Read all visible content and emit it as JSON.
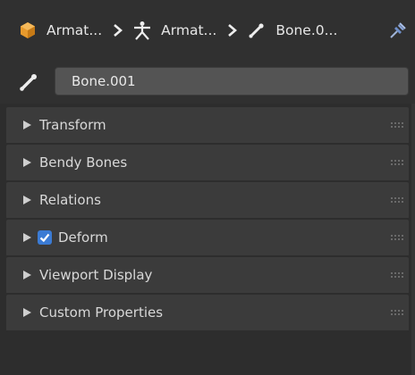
{
  "colors": {
    "panel_bg": "#2d2d2d",
    "header_bg": "#303030",
    "section_bg": "#3b3b3b",
    "field_bg": "#545454",
    "checkbox_accent": "#3b7bd4",
    "armature_orange": "#e89a2c"
  },
  "breadcrumb": {
    "items": [
      {
        "label": "Armat...",
        "icon": "armature-object-icon"
      },
      {
        "label": "Armat...",
        "icon": "armature-data-icon"
      },
      {
        "label": "Bone.0...",
        "icon": "bone-icon"
      }
    ],
    "separator_icon": "chevron-right-icon",
    "pin_icon": "pin-icon"
  },
  "name_field": {
    "icon": "bone-icon",
    "value": "Bone.001"
  },
  "sections": [
    {
      "label": "Transform",
      "expanded": false,
      "has_checkbox": false
    },
    {
      "label": "Bendy Bones",
      "expanded": false,
      "has_checkbox": false
    },
    {
      "label": "Relations",
      "expanded": false,
      "has_checkbox": false
    },
    {
      "label": "Deform",
      "expanded": false,
      "has_checkbox": true,
      "checked": true
    },
    {
      "label": "Viewport Display",
      "expanded": false,
      "has_checkbox": false
    },
    {
      "label": "Custom Properties",
      "expanded": false,
      "has_checkbox": false
    }
  ]
}
